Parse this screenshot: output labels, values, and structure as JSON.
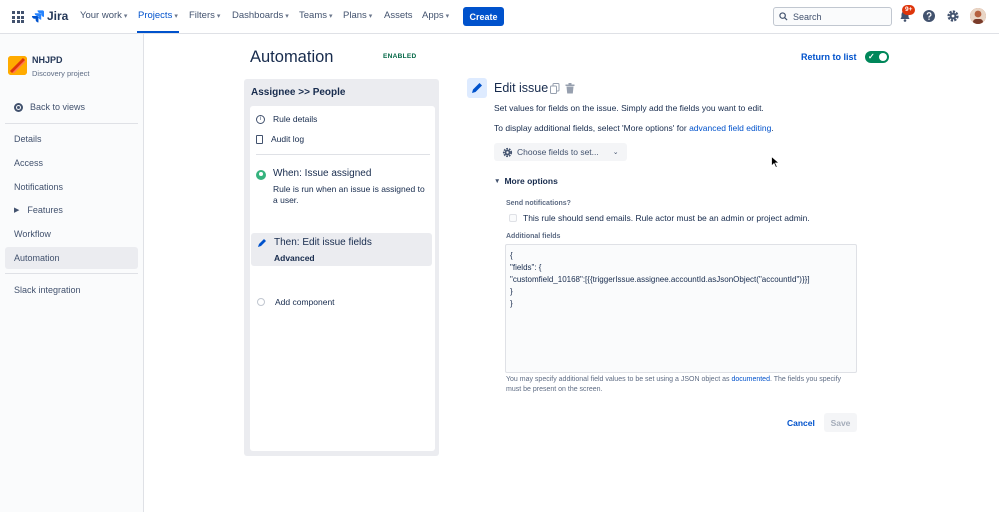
{
  "topnav": {
    "logo_text": "Jira",
    "items": [
      {
        "label": "Your work",
        "active": false
      },
      {
        "label": "Projects",
        "active": true
      },
      {
        "label": "Filters",
        "active": false
      },
      {
        "label": "Dashboards",
        "active": false
      },
      {
        "label": "Teams",
        "active": false
      },
      {
        "label": "Plans",
        "active": false
      },
      {
        "label": "Assets",
        "active": false
      },
      {
        "label": "Apps",
        "active": false
      }
    ],
    "create_label": "Create",
    "search_placeholder": "Search",
    "notifications_badge": "9+",
    "icons": [
      "app-switcher-icon",
      "notifications-icon",
      "help-icon",
      "settings-icon",
      "profile-avatar"
    ]
  },
  "sidebar": {
    "project_name": "NHJPD",
    "project_type": "Discovery project",
    "back_label": "Back to views",
    "items": [
      "Details",
      "Access",
      "Notifications",
      "Features",
      "Workflow",
      "Automation"
    ],
    "selected": "Automation",
    "slack_label": "Slack integration"
  },
  "header": {
    "title": "Automation",
    "status": "ENABLED",
    "return_label": "Return to list",
    "toggle_on": true
  },
  "rule": {
    "panel_title": "Assignee >> People",
    "rule_details": "Rule details",
    "audit_log": "Audit log",
    "trigger_title": "When: Issue assigned",
    "trigger_desc": "Rule is run when an issue is assigned to a user.",
    "action_title": "Then: Edit issue fields",
    "action_sub": "Advanced",
    "add_component": "Add component"
  },
  "detail": {
    "title": "Edit issue",
    "desc1": "Set values for fields on the issue. Simply add the fields you want to edit.",
    "desc2_prefix": "To display additional fields, select 'More options' for ",
    "desc2_link": "advanced field editing",
    "desc2_suffix": ".",
    "choose_label": "Choose fields to set...",
    "more_options": "More options",
    "notif_label": "Send notifications?",
    "notif_checkbox": "This rule should send emails. Rule actor must be an admin or project admin.",
    "additional_label": "Additional fields",
    "json_value": "{\n\"fields\": {\n\"customfield_10168\":[{{triggerIssue.assignee.accountId.asJsonObject(\"accountId\")}}]\n}\n}",
    "help_prefix": "You may specify additional field values to be set using a JSON object as ",
    "help_link": "documented",
    "help_suffix": ". The fields you specify must be present on the screen.",
    "cancel_label": "Cancel",
    "save_label": "Save"
  },
  "colors": {
    "brand": "#0052cc",
    "enabled": "#00875a",
    "badge": "#de350b"
  }
}
